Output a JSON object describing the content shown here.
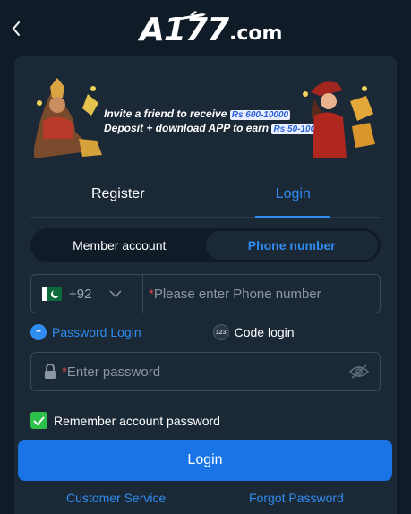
{
  "header": {
    "logo_main": "A177",
    "logo_suffix": ".com"
  },
  "banner": {
    "line1": "Invite a friend to receive",
    "line1_amount": "Rs 600-10000",
    "line2": "Deposit + download APP to earn",
    "line2_amount": "Rs 50-1000"
  },
  "tabs": [
    {
      "label": "Register",
      "active": false
    },
    {
      "label": "Login",
      "active": true
    }
  ],
  "account_type": {
    "options": [
      {
        "label": "Member account",
        "active": false
      },
      {
        "label": "Phone number",
        "active": true
      }
    ]
  },
  "phone": {
    "country_code": "+92",
    "required_mark": "*",
    "placeholder": "Please enter Phone number",
    "value": ""
  },
  "login_modes": {
    "password_label": "Password Login",
    "password_badge": "**",
    "code_label": "Code login",
    "code_badge": "123"
  },
  "password": {
    "required_mark": "*",
    "placeholder": "Enter password",
    "value": ""
  },
  "remember": {
    "label": "Remember account password",
    "checked": true
  },
  "login_button": "Login",
  "footer": {
    "customer_service": "Customer Service",
    "forgot_password": "Forgot Password"
  },
  "colors": {
    "background": "#0f1b27",
    "card": "#1b2836",
    "accent": "#2f8cf0",
    "button": "#1975e6",
    "checkbox": "#2fbf4b",
    "required": "#e0434b"
  }
}
